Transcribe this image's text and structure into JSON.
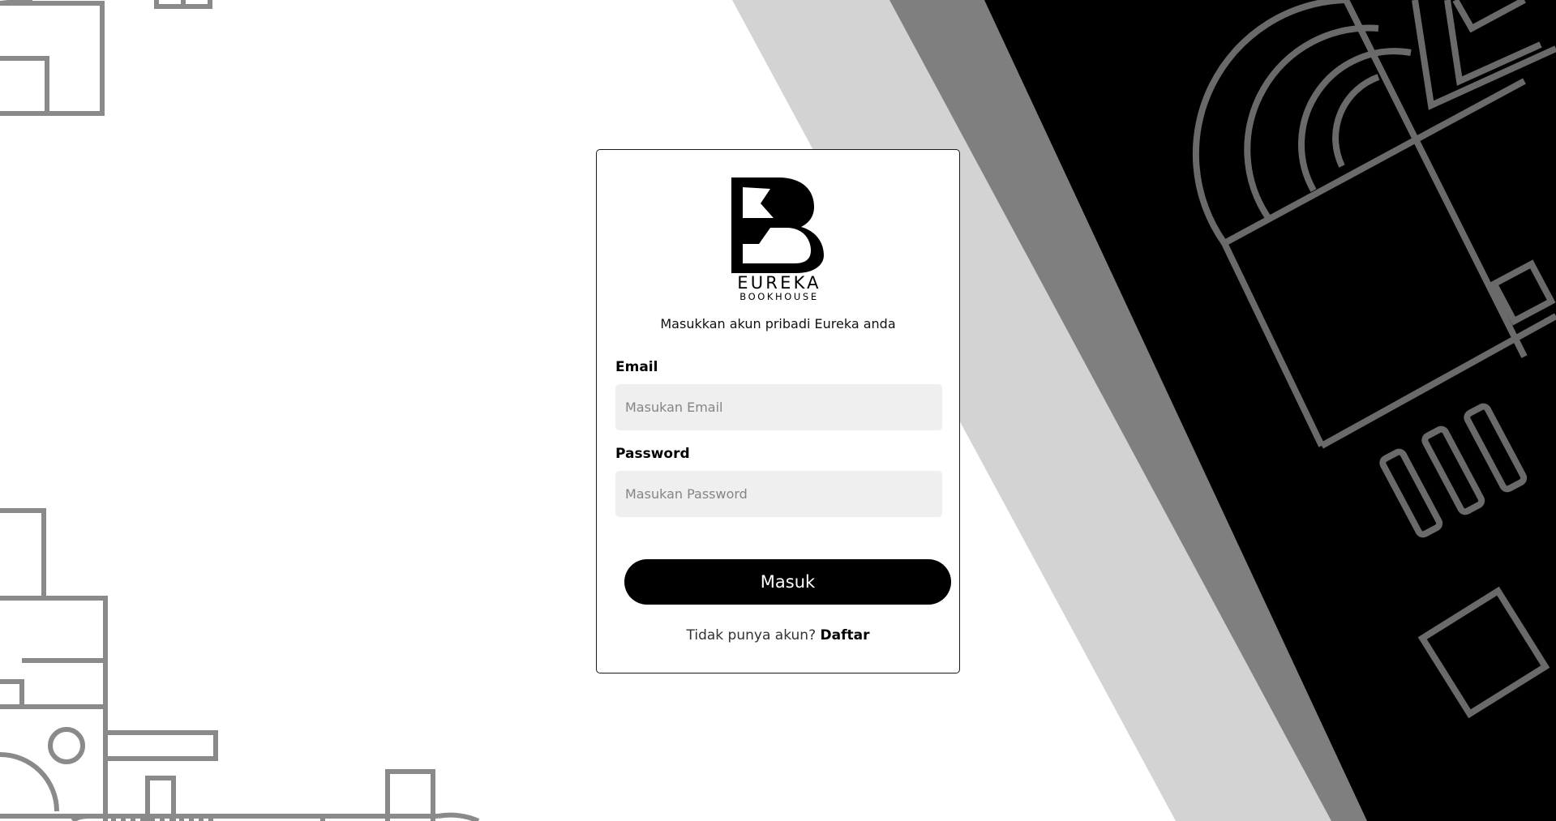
{
  "brand": {
    "name": "EUREKA",
    "sub": "BOOKHOUSE",
    "logo_icon": "eureka-b-logo"
  },
  "login": {
    "subtitle": "Masukkan akun pribadi Eureka anda",
    "email_label": "Email",
    "email_placeholder": "Masukan Email",
    "password_label": "Password",
    "password_placeholder": "Masukan Password",
    "submit_label": "Masuk",
    "register_prompt": "Tidak punya akun?",
    "register_link": "Daftar"
  },
  "colors": {
    "primary": "#000000",
    "input_bg": "#efefef",
    "line_art": "#8a8a8a",
    "stripe_light": "#d3d3d3",
    "stripe_mid": "#7f7f7f"
  }
}
